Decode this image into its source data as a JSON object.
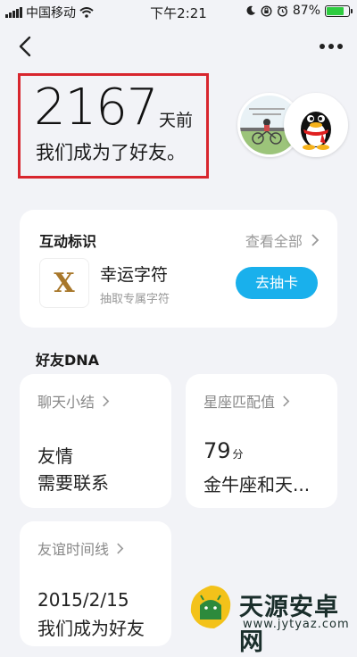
{
  "status_bar": {
    "carrier": "中国移动",
    "time": "下午2:21",
    "battery": "87%",
    "battery_level": 0.87,
    "battery_color": "#2ecc40"
  },
  "header": {
    "back_icon": "chevron-left-icon",
    "more_icon": "more-dots-icon"
  },
  "hero": {
    "days": "2167",
    "days_unit": "天前",
    "subtitle": "我们成为了好友。",
    "highlight_color": "#d8262e"
  },
  "interaction": {
    "title": "互动标识",
    "see_all": "查看全部",
    "card_icon_letter": "X",
    "card_title": "幸运字符",
    "card_subtitle": "抽取专属字符",
    "draw_button": "去抽卡",
    "button_color": "#19b0ec"
  },
  "dna": {
    "title": "好友DNA",
    "chat_summary": {
      "head": "聊天小结",
      "line1": "友情",
      "line2": "需要联系"
    },
    "zodiac": {
      "head": "星座匹配值",
      "score": "79",
      "score_unit": "分",
      "text": "金牛座和天..."
    },
    "timeline": {
      "head": "友谊时间线",
      "date": "2015/2/15",
      "text": "我们成为好友"
    }
  },
  "watermark": {
    "name": "天源安卓网",
    "url": "www.jytyaz.com"
  }
}
